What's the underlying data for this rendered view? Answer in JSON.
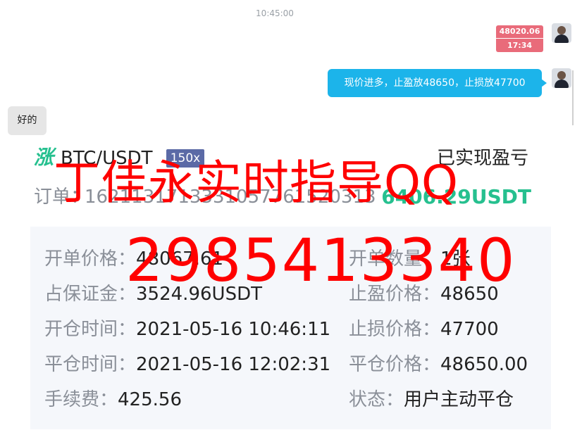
{
  "chat": {
    "timestamp": "10:45:00",
    "price_card": {
      "price": "48020.06",
      "time": "17:34"
    },
    "sent_message": "现价进多，止盈放48650，止损放47700",
    "received_message": "好的"
  },
  "order": {
    "trend_icon": "涨",
    "pair": "BTC/USDT",
    "leverage": "150x",
    "pnl_title": "已实现盈亏",
    "order_no_label": "订单：",
    "order_no": "1621131713331057761520313",
    "pnl_value": "6406.29USDT",
    "fields": {
      "open_price": {
        "label": "开单价格：",
        "value": "48067.61"
      },
      "quantity": {
        "label": "开单数量：",
        "value": "1张"
      },
      "margin": {
        "label": "占保证金：",
        "value": "3524.96USDT"
      },
      "take_profit": {
        "label": "止盈价格：",
        "value": "48650"
      },
      "open_time": {
        "label": "开仓时间：",
        "value": "2021-05-16 10:46:11"
      },
      "stop_loss": {
        "label": "止损价格：",
        "value": "47700"
      },
      "close_time": {
        "label": "平仓时间：",
        "value": "2021-05-16 12:02:31"
      },
      "close_price": {
        "label": "平仓价格：",
        "value": "48650.00"
      },
      "fee": {
        "label": "手续费：",
        "value": "425.56"
      },
      "status": {
        "label": "状态：",
        "value": "用户主动平仓"
      }
    }
  },
  "watermark": {
    "line1": "丁佳永实时指导QQ",
    "line2": "2985413340"
  },
  "colors": {
    "accent_blue": "#1cb4ea",
    "profit_green": "#26c08f",
    "price_red": "#e96b7a",
    "watermark_red": "#ff0000"
  }
}
